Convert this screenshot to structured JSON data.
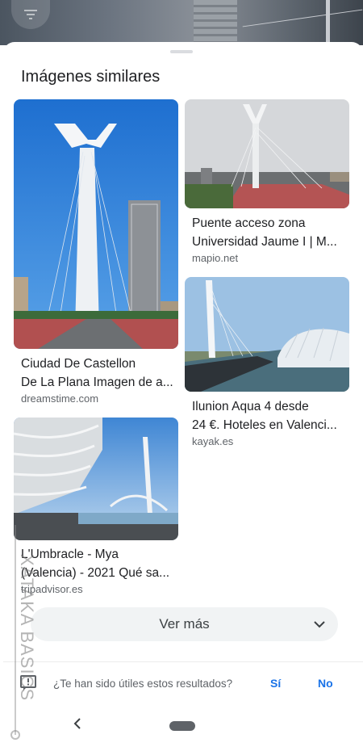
{
  "top": {
    "icon": "filter-icon"
  },
  "section_title": "Imágenes similares",
  "results": [
    {
      "caption_line1": "Ciudad De Castellon",
      "caption_line2": "De La Plana Imagen de a...",
      "source": "dreamstime.com"
    },
    {
      "caption_line1": "Puente acceso zona",
      "caption_line2": "Universidad Jaume I | M...",
      "source": "mapio.net"
    },
    {
      "caption_line1": "Ilunion Aqua 4 desde",
      "caption_line2": "24 €. Hoteles en Valenci...",
      "source": "kayak.es"
    },
    {
      "caption_line1": "L'Umbracle - Mya",
      "caption_line2": "(Valencia) - 2021 Qué sa...",
      "source": "tripadvisor.es"
    }
  ],
  "more": {
    "label": "Ver más",
    "icon": "chevron-down-icon"
  },
  "feedback": {
    "question": "¿Te han sido útiles estos resultados?",
    "yes": "Sí",
    "no": "No",
    "icon": "feedback-icon"
  },
  "nav": {
    "back_icon": "back-icon"
  },
  "watermark": {
    "text": "XATAKA BASICS"
  },
  "colors": {
    "accent": "#1a73e8",
    "button_bg": "#f1f3f4",
    "text": "#202124",
    "secondary": "#5f6368"
  }
}
